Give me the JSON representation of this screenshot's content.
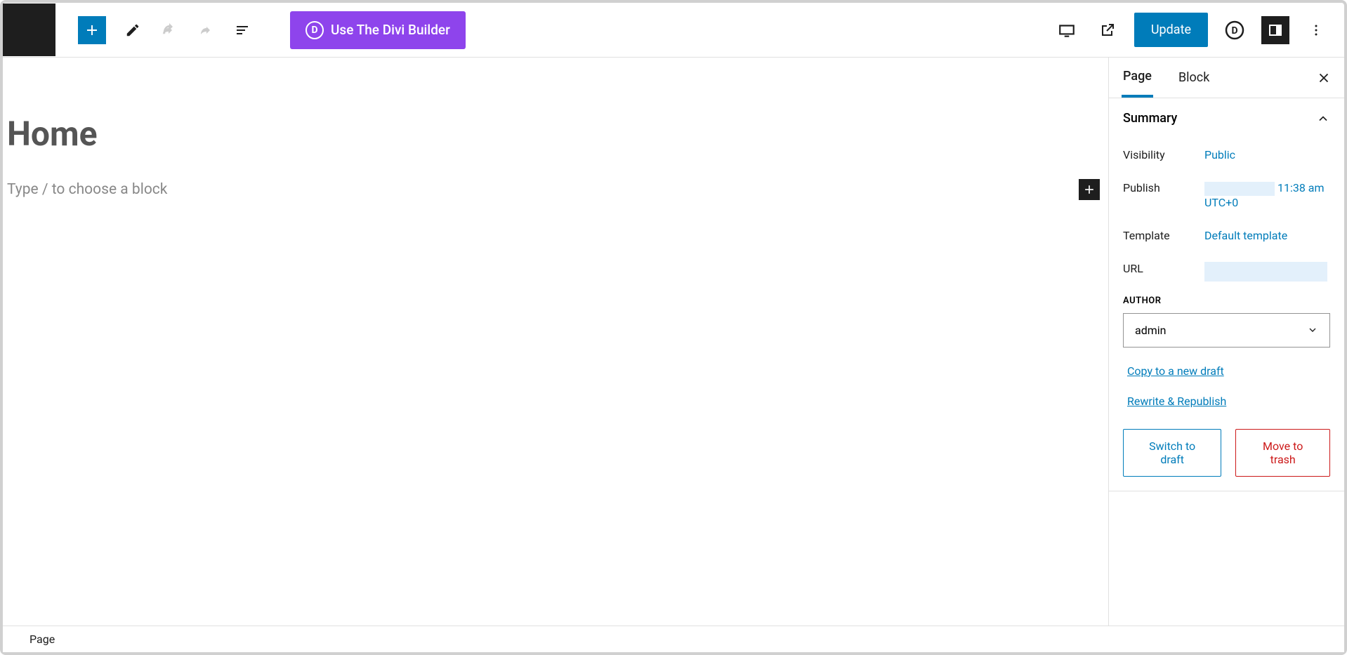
{
  "toolbar": {
    "divi_button_label": "Use The Divi Builder",
    "update_label": "Update"
  },
  "editor": {
    "page_title": "Home",
    "placeholder": "Type / to choose a block"
  },
  "sidebar": {
    "tabs": {
      "page": "Page",
      "block": "Block"
    },
    "summary": {
      "title": "Summary",
      "visibility_label": "Visibility",
      "visibility_value": "Public",
      "publish_label": "Publish",
      "publish_time": "11:38 am",
      "publish_tz": "UTC+0",
      "template_label": "Template",
      "template_value": "Default template",
      "url_label": "URL",
      "author_label": "AUTHOR",
      "author_value": "admin",
      "copy_draft": "Copy to a new draft",
      "rewrite": "Rewrite & Republish",
      "switch_draft": "Switch to draft",
      "move_trash": "Move to trash"
    }
  },
  "breadcrumb": "Page"
}
